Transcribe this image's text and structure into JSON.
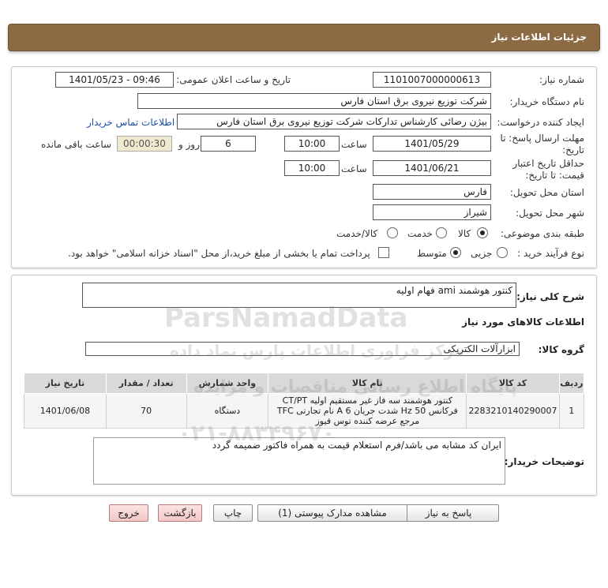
{
  "header": {
    "title": "جزئیات اطلاعات نیاز"
  },
  "form": {
    "need_number_label": "شماره نیاز:",
    "need_number": "1101007000000613",
    "announce_label": "تاریخ و ساعت اعلان عمومی:",
    "announce_value": "1401/05/23 - 09:46",
    "buyer_label": "نام دستگاه خریدار:",
    "buyer_value": "شرکت توزیع نیروی برق استان فارس",
    "creator_label": "ایجاد کننده درخواست:",
    "creator_value": "بیژن رضائی کارشناس تدارکات شرکت توزیع نیروی برق استان فارس",
    "contact_link": "اطلاعات تماس خریدار",
    "deadline_label_1": "مهلت ارسال پاسخ: تا",
    "deadline_label_2": "تاریخ:",
    "deadline_date": "1401/05/29",
    "time_label": "ساعت",
    "deadline_time": "10:00",
    "days_value": "6",
    "days_label": "روز و",
    "remaining_time": "00:00:30",
    "remaining_label": "ساعت باقی مانده",
    "validity_label_1": "حداقل تاریخ اعتبار",
    "validity_label_2": "قیمت: تا تاریخ:",
    "validity_date": "1401/06/21",
    "validity_time": "10:00",
    "province_label": "استان محل تحویل:",
    "province_value": "فارس",
    "city_label": "شهر محل تحویل:",
    "city_value": "شیراز",
    "category_label": "طبقه بندی موضوعی:",
    "category_options": [
      "کالا",
      "خدمت",
      "کالا/خدمت"
    ],
    "category_selected": "کالا",
    "process_label": "نوع فرآیند خرید :",
    "process_options": [
      "جزیی",
      "متوسط"
    ],
    "process_selected": "متوسط",
    "payment_note": "پرداخت تمام یا بخشی از مبلغ خرید،از محل \"اسناد خزانه اسلامی\" خواهد بود."
  },
  "summary": {
    "label": "شرح کلی نیاز:",
    "value": "کنتور هوشمند ami  فهام اولیه"
  },
  "goods_section": {
    "title": "اطلاعات کالاهای مورد نیاز",
    "group_label": "گروه کالا:",
    "group_value": "ابزارآلات الکتریکی"
  },
  "table": {
    "headers": [
      "ردیف",
      "کد کالا",
      "نام کالا",
      "واحد شمارش",
      "تعداد / مقدار",
      "تاریخ نیاز"
    ],
    "rows": [
      {
        "row": "1",
        "code": "2283210140290007",
        "name": "کنتور هوشمند سه فاز غیر مستقیم اولیه CT/PT فرکانس 50 Hz شدت جریان A 6 نام تجارتی TFC مرجع عرضه کننده توس فیوز",
        "unit": "دستگاه",
        "qty": "70",
        "date": "1401/06/08"
      }
    ]
  },
  "buyer_notes": {
    "label": "توضیحات خریدار:",
    "value": "ایران کد مشابه می باشد/فرم استعلام قیمت به همراه فاکتور ضمیمه گردد"
  },
  "buttons": {
    "reply": "پاسخ به نیاز",
    "attachments": "مشاهده مدارک پیوستی (1)",
    "print": "چاپ",
    "back": "بازگشت",
    "exit": "خروج"
  },
  "watermark": {
    "brand": "ParsNamadData",
    "line1": "مرکز فراوری اطلاعات پارس نماد داده",
    "line2": "پایگاه اطلاع رسانی مناقصات و مزایده",
    "phone": "۰۲۱-۸۸۳۴۹۶۷۰"
  },
  "colors": {
    "header_bg": "#8b6a44",
    "link": "#1a4fa8",
    "timer_bg": "#efe9d0"
  }
}
